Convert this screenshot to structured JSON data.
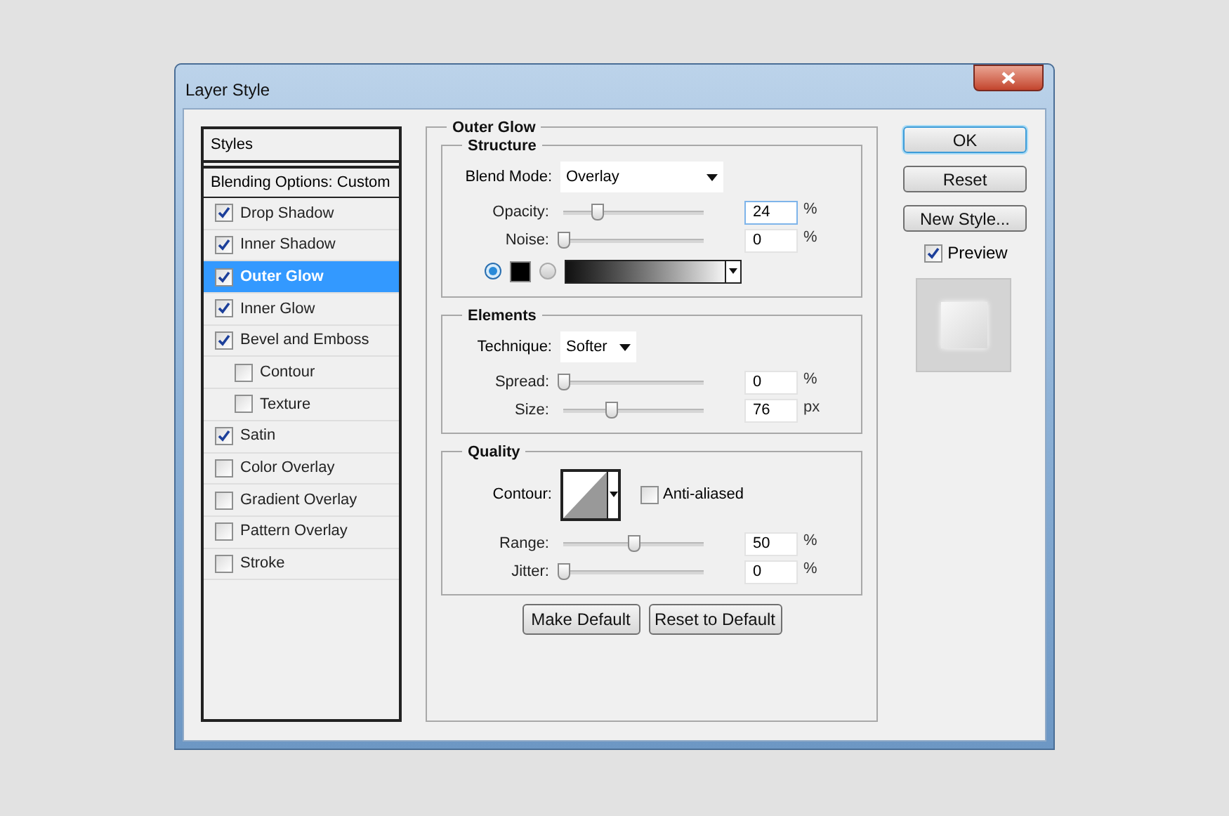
{
  "window": {
    "title": "Layer Style"
  },
  "styles_panel": {
    "header": "Styles",
    "blending": "Blending Options: Custom",
    "items": [
      {
        "label": "Drop Shadow",
        "checked": true,
        "selected": false
      },
      {
        "label": "Inner Shadow",
        "checked": true,
        "selected": false
      },
      {
        "label": "Outer Glow",
        "checked": true,
        "selected": true
      },
      {
        "label": "Inner Glow",
        "checked": true,
        "selected": false
      },
      {
        "label": "Bevel and Emboss",
        "checked": true,
        "selected": false,
        "children": [
          {
            "label": "Contour",
            "checked": false,
            "selected": false
          },
          {
            "label": "Texture",
            "checked": false,
            "selected": false
          }
        ]
      },
      {
        "label": "Satin",
        "checked": true,
        "selected": false
      },
      {
        "label": "Color Overlay",
        "checked": false,
        "selected": false
      },
      {
        "label": "Gradient Overlay",
        "checked": false,
        "selected": false
      },
      {
        "label": "Pattern Overlay",
        "checked": false,
        "selected": false
      },
      {
        "label": "Stroke",
        "checked": false,
        "selected": false
      }
    ]
  },
  "panel": {
    "title": "Outer Glow",
    "structure": {
      "title": "Structure",
      "blend_mode": {
        "label": "Blend Mode:",
        "value": "Overlay"
      },
      "sliders": [
        {
          "label": "Opacity:",
          "level": 0.24,
          "value": "24",
          "unit": "%",
          "focused": true
        },
        {
          "label": "Noise:",
          "level": 0,
          "value": "0",
          "unit": "%",
          "focused": false
        }
      ],
      "fill": [
        {
          "kind": "color",
          "selected": true,
          "color": "#000000"
        },
        {
          "kind": "gradient",
          "selected": false
        }
      ]
    },
    "elements": {
      "title": "Elements",
      "technique": {
        "label": "Technique:",
        "value": "Softer"
      },
      "sliders": [
        {
          "label": "Spread:",
          "level": 0,
          "value": "0",
          "unit": "%",
          "focused": false
        },
        {
          "label": "Size:",
          "level": 0.34,
          "value": "76",
          "unit": "px",
          "focused": false
        }
      ]
    },
    "quality": {
      "title": "Quality",
      "contour_label": "Contour:",
      "anti_aliased": {
        "label": "Anti-aliased",
        "checked": false
      },
      "sliders": [
        {
          "label": "Range:",
          "level": 0.5,
          "value": "50",
          "unit": "%",
          "focused": false
        },
        {
          "label": "Jitter:",
          "level": 0,
          "value": "0",
          "unit": "%",
          "focused": false
        }
      ]
    },
    "buttons": [
      "Make Default",
      "Reset to Default"
    ]
  },
  "actions": [
    {
      "label": "OK",
      "default": true
    },
    {
      "label": "Reset",
      "default": false
    },
    {
      "label": "New Style...",
      "default": false
    }
  ],
  "preview": {
    "label": "Preview",
    "checked": true
  }
}
